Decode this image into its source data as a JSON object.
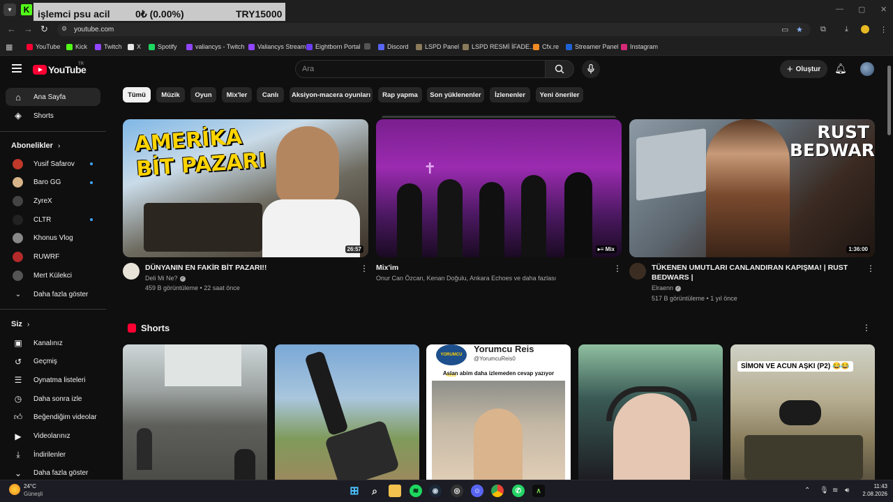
{
  "browser": {
    "ticker": {
      "label": "işlemci psu acil",
      "change": "0₺ (0.00%)",
      "price": "TRY15000"
    },
    "url": "youtube.com",
    "bookmarks": [
      {
        "label": "YouTube",
        "color": "#ff0033"
      },
      {
        "label": "Kick",
        "color": "#53fc18"
      },
      {
        "label": "Twitch",
        "color": "#9146ff"
      },
      {
        "label": "X",
        "color": "#e7e7e7"
      },
      {
        "label": "Spotify",
        "color": "#1ed760"
      },
      {
        "label": "valiancys - Twitch",
        "color": "#9146ff"
      },
      {
        "label": "Valiancys Stream",
        "color": "#9146ff"
      },
      {
        "label": "Eightborn Portal",
        "color": "#6b3df0"
      },
      {
        "label": "",
        "color": "#555555"
      },
      {
        "label": "Discord",
        "color": "#5865f2"
      },
      {
        "label": "LSPD Panel",
        "color": "#8a7a5a"
      },
      {
        "label": "LSPD  RESMİ İFADE...",
        "color": "#8a7a5a"
      },
      {
        "label": "Cfx.re",
        "color": "#f08a24"
      },
      {
        "label": "Streamer Panel",
        "color": "#1e63d6"
      },
      {
        "label": "Instagram",
        "color": "#d62976"
      }
    ]
  },
  "header": {
    "logo_text": "YouTube",
    "logo_sup": "TR",
    "search_placeholder": "Ara",
    "create_label": "Oluştur"
  },
  "sidebar": {
    "main": [
      {
        "label": "Ana Sayfa",
        "icon": "home-icon"
      },
      {
        "label": "Shorts",
        "icon": "shorts-icon"
      }
    ],
    "subs_heading": "Abonelikler",
    "subs": [
      {
        "label": "Yusif Safarov",
        "dot": true,
        "color": "#c0392b"
      },
      {
        "label": "Baro GG",
        "dot": true,
        "color": "#d8b48a"
      },
      {
        "label": "ZyreX",
        "dot": false,
        "color": "#444444"
      },
      {
        "label": "CLTR",
        "dot": true,
        "color": "#222222"
      },
      {
        "label": "Khonus Vlog",
        "dot": false,
        "color": "#888888"
      },
      {
        "label": "RUWRF",
        "dot": false,
        "color": "#b52a2a"
      },
      {
        "label": "Mert Külekci",
        "dot": false,
        "color": "#555555"
      }
    ],
    "show_more_subs": "Daha fazla göster",
    "you_heading": "Siz",
    "you": [
      {
        "label": "Kanalınız",
        "icon": "channel-icon"
      },
      {
        "label": "Geçmiş",
        "icon": "history-icon"
      },
      {
        "label": "Oynatma listeleri",
        "icon": "playlist-icon"
      },
      {
        "label": "Daha sonra izle",
        "icon": "watch-later-icon"
      },
      {
        "label": "Beğendiğim videolar",
        "icon": "like-icon"
      },
      {
        "label": "Videolarınız",
        "icon": "video-icon"
      },
      {
        "label": "İndirilenler",
        "icon": "download-icon"
      },
      {
        "label": "Daha fazla göster",
        "icon": "chevron-down-icon"
      }
    ]
  },
  "chips": [
    "Tümü",
    "Müzik",
    "Oyun",
    "Mix'ler",
    "Canlı",
    "Aksiyon-macera oyunları",
    "Rap yapma",
    "Son yüklenenler",
    "İzlenenler",
    "Yeni öneriler"
  ],
  "videos": [
    {
      "thumb_text": "AMERİKA BİT PAZARI",
      "duration": "26:57",
      "title": "DÜNYANIN EN FAKİR BİT PAZARI!!",
      "channel": "Deli Mi Ne?",
      "verified": true,
      "meta": "459 B görüntüleme • 22 saat önce"
    },
    {
      "thumb_text": "",
      "duration": "Mix",
      "title": "Mix'im",
      "channel": "Onur Can Özcan, Kenan Doğulu, Ankara Echoes ve daha fazlası",
      "verified": false,
      "meta": ""
    },
    {
      "thumb_text": "RUST BEDWARS",
      "duration": "1:36:00",
      "title": "TÜKENEN UMUTLARI CANLANDIRAN KAPIŞMA! | RUST BEDWARS |",
      "channel": "Elraenn",
      "verified": true,
      "meta": "517 B görüntüleme • 1 yıl önce"
    }
  ],
  "shorts": {
    "heading": "Shorts",
    "items": [
      {
        "caption": ""
      },
      {
        "caption": ""
      },
      {
        "caption": "Aslan abim daha izlemeden cevap yazıyor",
        "account_name": "Yorumcu Reis",
        "account_handle": "@YorumcuReis0",
        "badge": "YORUMCU REIS"
      },
      {
        "caption": ""
      },
      {
        "caption": "SİMON VE ACUN AŞKI (P2) 😂😂"
      }
    ]
  },
  "taskbar": {
    "weather_temp": "24°C",
    "weather_desc": "Güneşli",
    "time": "11:43",
    "date": "2.08.2026"
  }
}
